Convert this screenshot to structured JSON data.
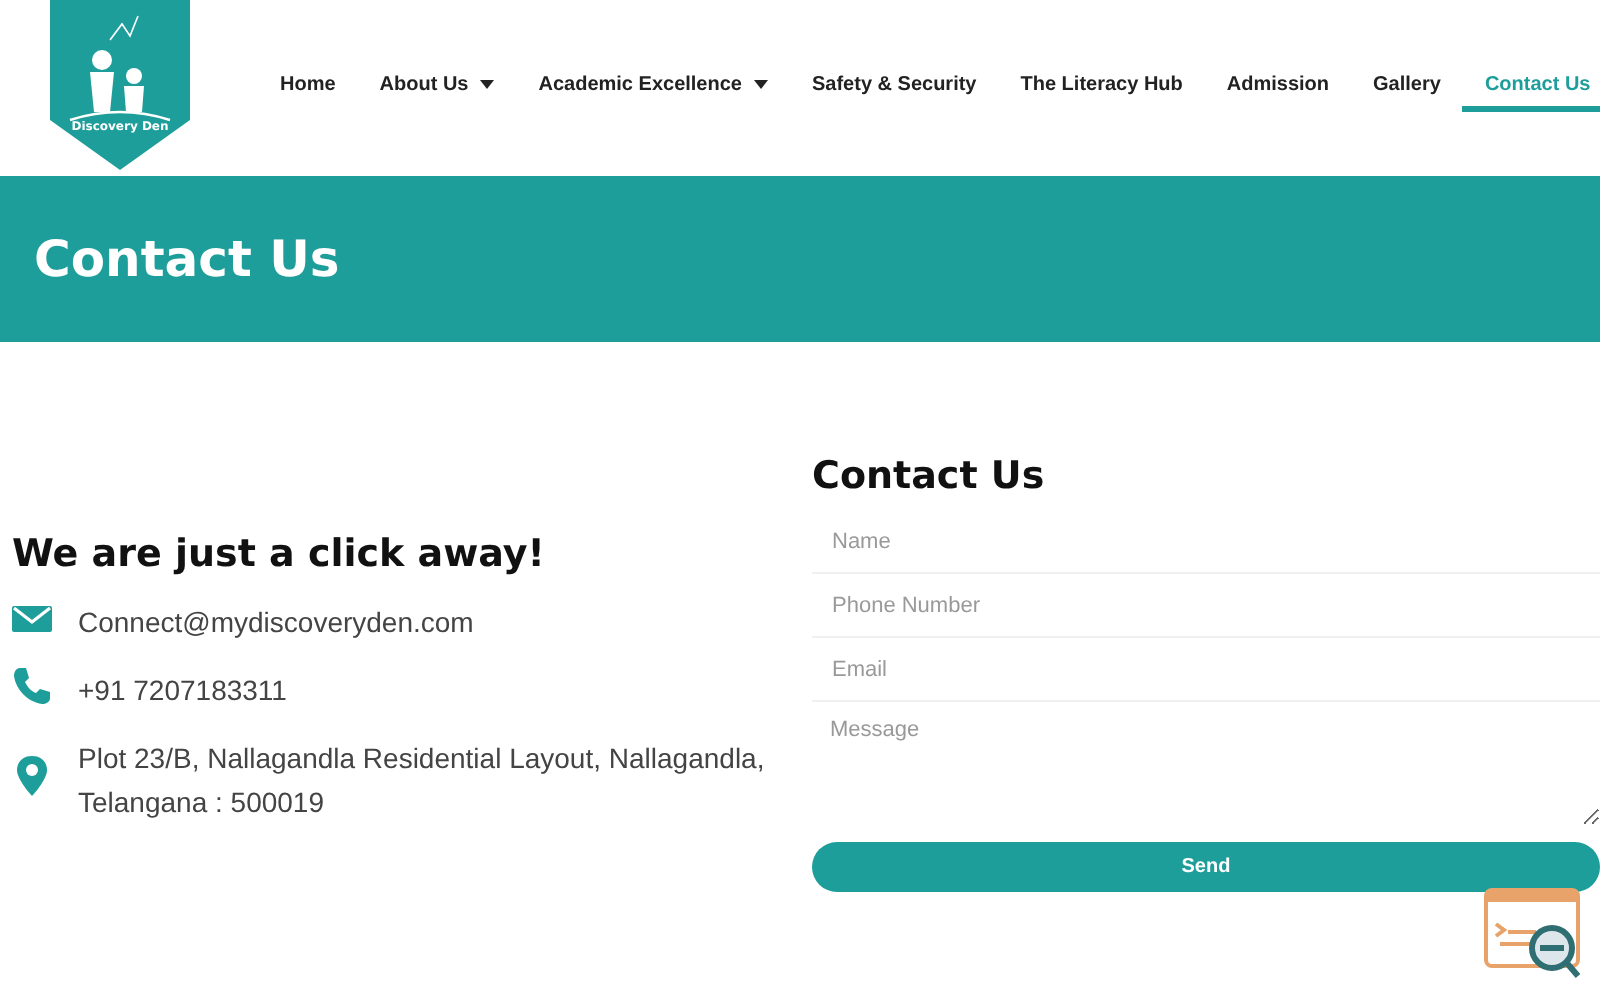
{
  "logo": {
    "text": "Discovery Den"
  },
  "nav": [
    {
      "label": "Home",
      "dropdown": false,
      "selected": false
    },
    {
      "label": "About Us",
      "dropdown": true,
      "selected": false
    },
    {
      "label": "Academic Excellence",
      "dropdown": true,
      "selected": false
    },
    {
      "label": "Safety & Security",
      "dropdown": false,
      "selected": false
    },
    {
      "label": "The Literacy Hub",
      "dropdown": false,
      "selected": false
    },
    {
      "label": "Admission",
      "dropdown": false,
      "selected": false
    },
    {
      "label": "Gallery",
      "dropdown": false,
      "selected": false
    },
    {
      "label": "Contact Us",
      "dropdown": false,
      "selected": true
    }
  ],
  "banner": {
    "title": "Contact Us"
  },
  "contact_info": {
    "heading": "We are just a click away!",
    "items": [
      {
        "kind": "email",
        "text": "Connect@mydiscoveryden.com"
      },
      {
        "kind": "phone",
        "text": "+91 7207183311"
      },
      {
        "kind": "location",
        "text": "Plot 23/B, Nallagandla Residential Layout, Nallagandla, Telangana : 500019"
      }
    ]
  },
  "form": {
    "heading": "Contact Us",
    "fields": [
      {
        "kind": "input",
        "placeholder": "Name"
      },
      {
        "kind": "input",
        "placeholder": "Phone Number"
      },
      {
        "kind": "input",
        "placeholder": "Email"
      },
      {
        "kind": "textarea",
        "placeholder": "Message"
      }
    ],
    "button": "Send"
  }
}
